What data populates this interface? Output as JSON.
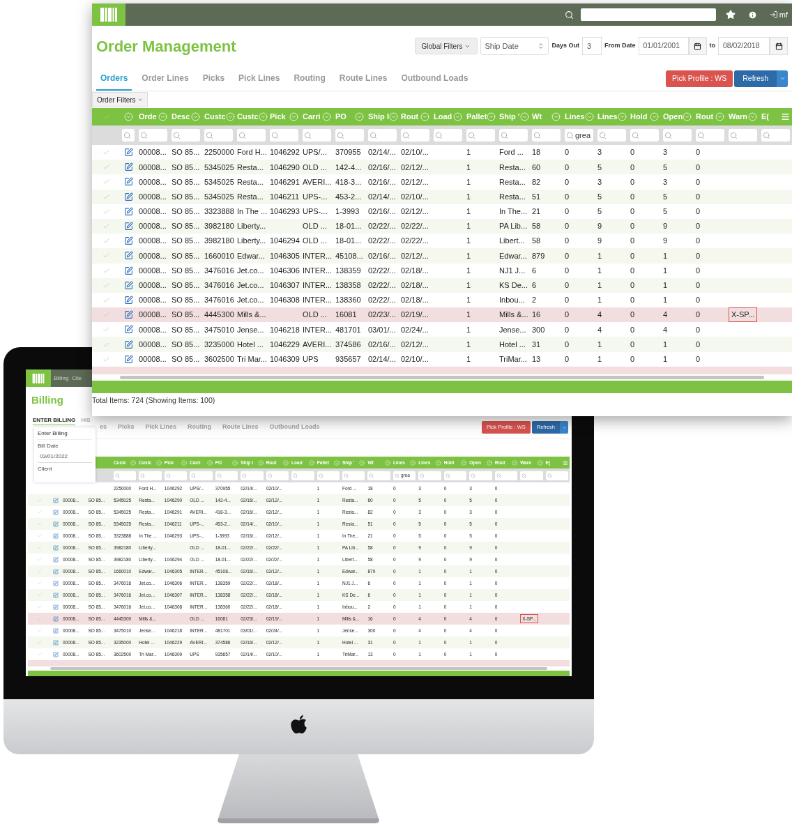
{
  "order_window": {
    "top_bar": {
      "user": "mf"
    },
    "title": "Order Management",
    "global_filters": "Global Filters",
    "date_field": {
      "value": "Ship Date"
    },
    "days_out": {
      "label": "Days Out",
      "value": "3"
    },
    "from_date": {
      "label": "From Date",
      "value": "01/01/2001"
    },
    "to_date": {
      "label": "to",
      "value": "08/02/2018"
    },
    "tabs": [
      {
        "label": "Orders",
        "selected": true
      },
      {
        "label": "Order Lines",
        "selected": false
      },
      {
        "label": "Picks",
        "selected": false
      },
      {
        "label": "Pick Lines",
        "selected": false
      },
      {
        "label": "Routing",
        "selected": false
      },
      {
        "label": "Route Lines",
        "selected": false
      },
      {
        "label": "Outbound Loads",
        "selected": false
      }
    ],
    "buttons": {
      "profile": "Pick Profile : WS",
      "refresh": "Refresh"
    },
    "order_filters": "Order Filters",
    "table": {
      "columns": [
        {
          "label": "Orde"
        },
        {
          "label": "Desc"
        },
        {
          "label": "Custc"
        },
        {
          "label": "Custc"
        },
        {
          "label": "Pick"
        },
        {
          "label": "Carri"
        },
        {
          "label": "PO"
        },
        {
          "label": "Ship I"
        },
        {
          "label": "Rout"
        },
        {
          "label": "Load"
        },
        {
          "label": "Pallet"
        },
        {
          "label": "Ship '"
        },
        {
          "label": "Wt"
        },
        {
          "label": "Lines",
          "filter": "grea"
        },
        {
          "label": "Lines"
        },
        {
          "label": "Hold"
        },
        {
          "label": "Open"
        },
        {
          "label": "Rout"
        },
        {
          "label": "Warn"
        },
        {
          "label": "E("
        }
      ],
      "rows": [
        {
          "flagged": false,
          "cells": [
            "00008...",
            "SO 85...",
            "2250000",
            "Ford H...",
            "1046292",
            "UPS/...",
            "370955",
            "02/14/...",
            "02/10/...",
            null,
            "1",
            "Ford ...",
            "18",
            "0",
            "3",
            "0",
            "3",
            "0",
            null,
            null
          ]
        },
        {
          "flagged": false,
          "cells": [
            "00008...",
            "SO 85...",
            "5345025",
            "Resta...",
            "1046290",
            "OLD ...",
            "142-4...",
            "02/16/...",
            "02/12/...",
            null,
            "1",
            "Resta...",
            "60",
            "0",
            "5",
            "0",
            "5",
            "0",
            null,
            null
          ]
        },
        {
          "flagged": false,
          "cells": [
            "00008...",
            "SO 85...",
            "5345025",
            "Resta...",
            "1046291",
            "AVERI...",
            "418-3...",
            "02/16/...",
            "02/12/...",
            null,
            "1",
            "Resta...",
            "82",
            "0",
            "3",
            "0",
            "3",
            "0",
            null,
            null
          ]
        },
        {
          "flagged": false,
          "cells": [
            "00008...",
            "SO 85...",
            "5345025",
            "Resta...",
            "1046211",
            "UPS-...",
            "453-2...",
            "02/14/...",
            "02/10/...",
            null,
            "1",
            "Resta...",
            "51",
            "0",
            "5",
            "0",
            "5",
            "0",
            null,
            null
          ]
        },
        {
          "flagged": false,
          "cells": [
            "00008...",
            "SO 85...",
            "3323888",
            "In The ...",
            "1046293",
            "UPS-...",
            "1-3993",
            "02/16/...",
            "02/12/...",
            null,
            "1",
            "In The...",
            "21",
            "0",
            "5",
            "0",
            "5",
            "0",
            null,
            null
          ]
        },
        {
          "flagged": false,
          "cells": [
            "00008...",
            "SO 85...",
            "3982180",
            "Liberty...",
            null,
            "OLD ...",
            "18-01...",
            "02/22/...",
            "02/22/...",
            null,
            "1",
            "PA Lib...",
            "58",
            "0",
            "9",
            "0",
            "9",
            "0",
            null,
            null
          ]
        },
        {
          "flagged": false,
          "cells": [
            "00008...",
            "SO 85...",
            "3982180",
            "Liberty...",
            "1046294",
            "OLD ...",
            "18-01...",
            "02/22/...",
            "02/22/...",
            null,
            "1",
            "Libert...",
            "58",
            "0",
            "9",
            "0",
            "9",
            "0",
            null,
            null
          ]
        },
        {
          "flagged": false,
          "cells": [
            "00008...",
            "SO 85...",
            "1660010",
            "Edwar...",
            "1046305",
            "INTER...",
            "45108...",
            "02/16/...",
            "02/12/...",
            null,
            "1",
            "Edwar...",
            "879",
            "0",
            "1",
            "0",
            "1",
            "0",
            null,
            null
          ]
        },
        {
          "flagged": false,
          "cells": [
            "00008...",
            "SO 85...",
            "3476016",
            "Jet.co...",
            "1046306",
            "INTER...",
            "138359",
            "02/22/...",
            "02/18/...",
            null,
            "1",
            "NJ1 J...",
            "6",
            "0",
            "1",
            "0",
            "1",
            "0",
            null,
            null
          ]
        },
        {
          "flagged": false,
          "cells": [
            "00008...",
            "SO 85...",
            "3476016",
            "Jet.co...",
            "1046307",
            "INTER...",
            "138358",
            "02/22/...",
            "02/18/...",
            null,
            "1",
            "KS De...",
            "6",
            "0",
            "1",
            "0",
            "1",
            "0",
            null,
            null
          ]
        },
        {
          "flagged": false,
          "cells": [
            "00008...",
            "SO 85...",
            "3476016",
            "Jet.co...",
            "1046308",
            "INTER...",
            "138360",
            "02/22/...",
            "02/18/...",
            null,
            "1",
            "Inbou...",
            "2",
            "0",
            "1",
            "0",
            "1",
            "0",
            null,
            null
          ]
        },
        {
          "flagged": true,
          "cells": [
            "00008...",
            "SO 85...",
            "4445300",
            "Mills &...",
            null,
            "OLD ...",
            "16081",
            "02/23/...",
            "02/19/...",
            null,
            "1",
            "Mills &...",
            "16",
            "0",
            "4",
            "0",
            "4",
            "0",
            "X-SP...",
            null
          ]
        },
        {
          "flagged": false,
          "cells": [
            "00008...",
            "SO 85...",
            "3475010",
            "Jense...",
            "1046218",
            "INTER...",
            "481701",
            "03/01/...",
            "02/24/...",
            null,
            "1",
            "Jense...",
            "300",
            "0",
            "4",
            "0",
            "4",
            "0",
            null,
            null
          ]
        },
        {
          "flagged": false,
          "cells": [
            "00008...",
            "SO 85...",
            "3235000",
            "Hotel ...",
            "1046229",
            "AVERI...",
            "374586",
            "02/16/...",
            "02/12/...",
            null,
            "1",
            "Hotel ...",
            "31",
            "0",
            "1",
            "0",
            "1",
            "0",
            null,
            null
          ]
        },
        {
          "flagged": false,
          "cells": [
            "00008...",
            "SO 85...",
            "3602500",
            "Tri Mar...",
            "1046309",
            "UPS",
            "935657",
            "02/14/...",
            "02/10/...",
            null,
            "1",
            "TriMar...",
            "13",
            "0",
            "1",
            "0",
            "1",
            "0",
            null,
            null
          ]
        }
      ],
      "cut_row": {
        "flagged": true
      }
    },
    "footer": "Total Items: 724 (Showing Items: 100)"
  },
  "monitor": {
    "billing": {
      "header_items": [
        "Billing",
        "Clie"
      ],
      "title": "Billing",
      "tabs": [
        {
          "label": "ENTER BILLING",
          "selected": true
        },
        {
          "label": "HIS",
          "selected": false
        }
      ],
      "panel": {
        "heading": "Enter Billing",
        "bill_date": {
          "label": "Bill Date",
          "value": "03/01/2022"
        },
        "client_label": "Client"
      }
    },
    "orders": {
      "tabs": [
        {
          "label": "es",
          "selected": false
        },
        {
          "label": "Picks",
          "selected": false
        },
        {
          "label": "Pick Lines",
          "selected": false
        },
        {
          "label": "Routing",
          "selected": false
        },
        {
          "label": "Route Lines",
          "selected": false
        },
        {
          "label": "Outbound Loads",
          "selected": false
        }
      ],
      "buttons": {
        "profile": "Pick Profile : WS",
        "refresh": "Refresh"
      },
      "table": {
        "columns": [
          {},
          {},
          {
            "label": "Custc"
          },
          {
            "label": "Custc"
          },
          {
            "label": "Pick"
          },
          {
            "label": "Carri"
          },
          {
            "label": "PO"
          },
          {
            "label": "Ship I"
          },
          {
            "label": "Rout"
          },
          {
            "label": "Load"
          },
          {
            "label": "Pallet"
          },
          {
            "label": "Ship '"
          },
          {
            "label": "Wt"
          },
          {
            "label": "Lines",
            "filter": "grea"
          },
          {
            "label": "Lines"
          },
          {
            "label": "Hold"
          },
          {
            "label": "Open"
          },
          {
            "label": "Rout"
          },
          {
            "label": "Warn"
          },
          {
            "label": "E("
          }
        ],
        "rows": [
          {
            "flagged": false,
            "cells": [
              null,
              null,
              "2250000",
              "Ford H...",
              "1046292",
              "UPS/...",
              "370955",
              "02/14/...",
              "02/10/...",
              null,
              "1",
              "Ford ...",
              "18",
              "0",
              "3",
              "0",
              "3",
              "0",
              null,
              null
            ]
          },
          {
            "flagged": false,
            "cells": [
              "00008...",
              "SO 85...",
              "5345025",
              "Resta...",
              "1046290",
              "OLD ...",
              "142-4...",
              "02/16/...",
              "02/12/...",
              null,
              "1",
              "Resta...",
              "60",
              "0",
              "5",
              "0",
              "5",
              "0",
              null,
              null
            ]
          },
          {
            "flagged": false,
            "cells": [
              "00008...",
              "SO 85...",
              "5345025",
              "Resta...",
              "1046291",
              "AVERI...",
              "418-3...",
              "02/16/...",
              "02/12/...",
              null,
              "1",
              "Resta...",
              "82",
              "0",
              "3",
              "0",
              "3",
              "0",
              null,
              null
            ]
          },
          {
            "flagged": false,
            "cells": [
              "00008...",
              "SO 85...",
              "5345025",
              "Resta...",
              "1046211",
              "UPS-...",
              "453-2...",
              "02/14/...",
              "02/10/...",
              null,
              "1",
              "Resta...",
              "51",
              "0",
              "5",
              "0",
              "5",
              "0",
              null,
              null
            ]
          },
          {
            "flagged": false,
            "cells": [
              "00008...",
              "SO 85...",
              "3323888",
              "In The ...",
              "1046293",
              "UPS-...",
              "1-3993",
              "02/16/...",
              "02/12/...",
              null,
              "1",
              "In The...",
              "21",
              "0",
              "5",
              "0",
              "5",
              "0",
              null,
              null
            ]
          },
          {
            "flagged": false,
            "cells": [
              "00008...",
              "SO 85...",
              "3982180",
              "Liberty...",
              null,
              "OLD ...",
              "18-01...",
              "02/22/...",
              "02/22/...",
              null,
              "1",
              "PA Lib...",
              "58",
              "0",
              "9",
              "0",
              "9",
              "0",
              null,
              null
            ]
          },
          {
            "flagged": false,
            "cells": [
              "00008...",
              "SO 85...",
              "3982180",
              "Liberty...",
              "1046294",
              "OLD ...",
              "18-01...",
              "02/22/...",
              "02/22/...",
              null,
              "1",
              "Libert...",
              "58",
              "0",
              "9",
              "0",
              "9",
              "0",
              null,
              null
            ]
          },
          {
            "flagged": false,
            "cells": [
              "00008...",
              "SO 85...",
              "1660010",
              "Edwar...",
              "1046305",
              "INTER...",
              "45108...",
              "02/16/...",
              "02/12/...",
              null,
              "1",
              "Edwar...",
              "879",
              "0",
              "1",
              "0",
              "1",
              "0",
              null,
              null
            ]
          },
          {
            "flagged": false,
            "cells": [
              "00008...",
              "SO 85...",
              "3476016",
              "Jet.co...",
              "1046306",
              "INTER...",
              "138359",
              "02/22/...",
              "02/18/...",
              null,
              "1",
              "NJ1 J...",
              "6",
              "0",
              "1",
              "0",
              "1",
              "0",
              null,
              null
            ]
          },
          {
            "flagged": false,
            "cells": [
              "00008...",
              "SO 85...",
              "3476016",
              "Jet.co...",
              "1046307",
              "INTER...",
              "138358",
              "02/22/...",
              "02/18/...",
              null,
              "1",
              "KS De...",
              "6",
              "0",
              "1",
              "0",
              "1",
              "0",
              null,
              null
            ]
          },
          {
            "flagged": false,
            "cells": [
              "00008...",
              "SO 85...",
              "3476016",
              "Jet.co...",
              "1046308",
              "INTER...",
              "138360",
              "02/22/...",
              "02/18/...",
              null,
              "1",
              "Inbou...",
              "2",
              "0",
              "1",
              "0",
              "1",
              "0",
              null,
              null
            ]
          },
          {
            "flagged": true,
            "cells": [
              "00008...",
              "SO 85...",
              "4445300",
              "Mills &...",
              null,
              "OLD ...",
              "16081",
              "02/23/...",
              "02/19/...",
              null,
              "1",
              "Mills &...",
              "16",
              "0",
              "4",
              "0",
              "4",
              "0",
              "X-SP...",
              null
            ]
          },
          {
            "flagged": false,
            "cells": [
              "00008...",
              "SO 85...",
              "3475010",
              "Jense...",
              "1046218",
              "INTER...",
              "481701",
              "03/01/...",
              "02/24/...",
              null,
              "1",
              "Jense...",
              "300",
              "0",
              "4",
              "0",
              "4",
              "0",
              null,
              null
            ]
          },
          {
            "flagged": false,
            "cells": [
              "00008...",
              "SO 85...",
              "3235000",
              "Hotel ...",
              "1046229",
              "AVERI...",
              "374586",
              "02/16/...",
              "02/12/...",
              null,
              "1",
              "Hotel ...",
              "31",
              "0",
              "1",
              "0",
              "1",
              "0",
              null,
              null
            ]
          },
          {
            "flagged": false,
            "cells": [
              "00008...",
              "SO 85...",
              "3602500",
              "Tri Mar...",
              "1046309",
              "UPS",
              "935657",
              "02/14/...",
              "02/10/...",
              null,
              "1",
              "TriMar...",
              "13",
              "0",
              "1",
              "0",
              "1",
              "0",
              null,
              null
            ]
          }
        ],
        "cut_row": {
          "flagged": true
        }
      }
    }
  }
}
